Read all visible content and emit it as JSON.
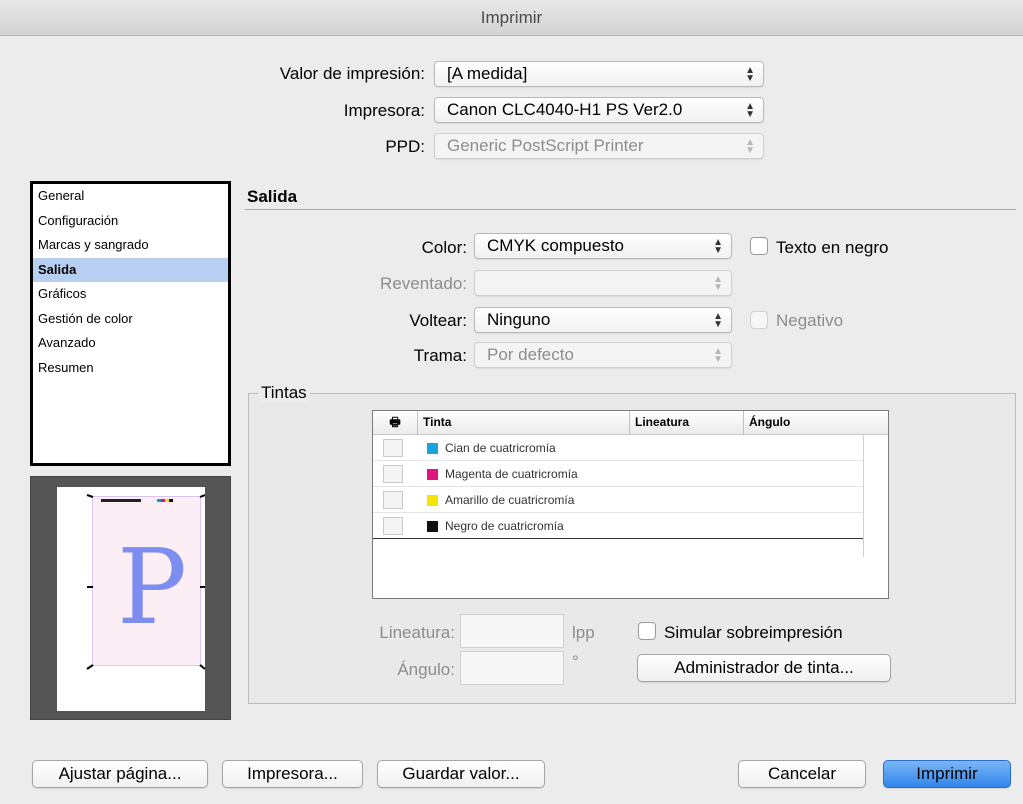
{
  "window": {
    "title": "Imprimir"
  },
  "print_settings": {
    "preset_label": "Valor de impresión:",
    "preset_value": "[A medida]",
    "printer_label": "Impresora:",
    "printer_value": "Canon CLC4040-H1 PS Ver2.0",
    "ppd_label": "PPD:",
    "ppd_value": "Generic PostScript Printer"
  },
  "sidebar": {
    "items": [
      {
        "label": "General"
      },
      {
        "label": "Configuración"
      },
      {
        "label": "Marcas y sangrado"
      },
      {
        "label": "Salida"
      },
      {
        "label": "Gráficos"
      },
      {
        "label": "Gestión de color"
      },
      {
        "label": "Avanzado"
      },
      {
        "label": "Resumen"
      }
    ],
    "selected_index": 3
  },
  "preview": {
    "glyph": "P"
  },
  "output": {
    "section_title": "Salida",
    "color_label": "Color:",
    "color_value": "CMYK compuesto",
    "text_black_label": "Texto en negro",
    "trapping_label": "Reventado:",
    "trapping_value": "",
    "flip_label": "Voltear:",
    "flip_value": "Ninguno",
    "negative_label": "Negativo",
    "screen_label": "Trama:",
    "screen_value": "Por defecto"
  },
  "inks": {
    "group_title": "Tintas",
    "columns": [
      "Tinta",
      "Lineatura",
      "Ángulo"
    ],
    "rows": [
      {
        "name": "Cian de cuatricromía",
        "color": "#1aa3e0"
      },
      {
        "name": "Magenta de cuatricromía",
        "color": "#e0147f"
      },
      {
        "name": "Amarillo de cuatricromía",
        "color": "#f2e600"
      },
      {
        "name": "Negro de cuatricromía",
        "color": "#111111"
      }
    ],
    "frequency_label": "Lineatura:",
    "frequency_unit": "lpp",
    "angle_label": "Ángulo:",
    "angle_unit": "°",
    "simulate_overprint_label": "Simular sobreimpresión",
    "ink_manager_label": "Administrador de tinta..."
  },
  "footer": {
    "page_setup_label": "Ajustar página...",
    "printer_button_label": "Impresora...",
    "save_preset_label": "Guardar valor...",
    "cancel_label": "Cancelar",
    "print_label": "Imprimir"
  },
  "icons": {
    "printer_icon": "printer-icon",
    "popup_arrows": "updown-arrows-icon"
  }
}
